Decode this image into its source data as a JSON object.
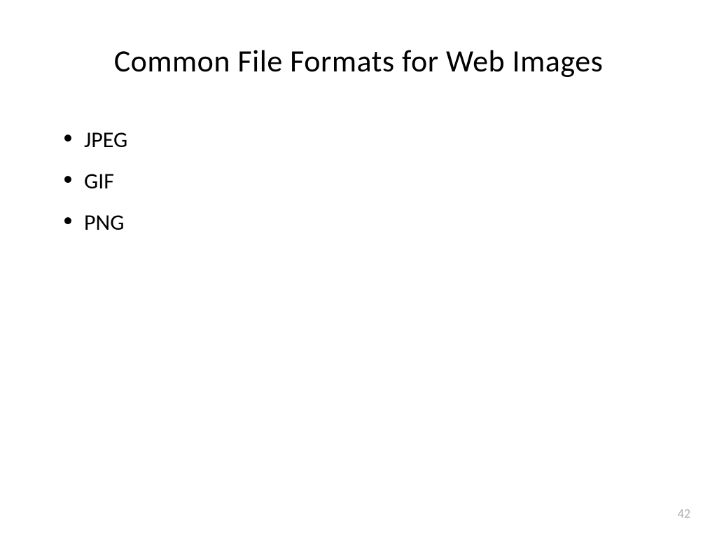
{
  "title": "Common File Formats for Web Images",
  "bullets": [
    "JPEG",
    "GIF",
    "PNG"
  ],
  "pageNumber": "42"
}
